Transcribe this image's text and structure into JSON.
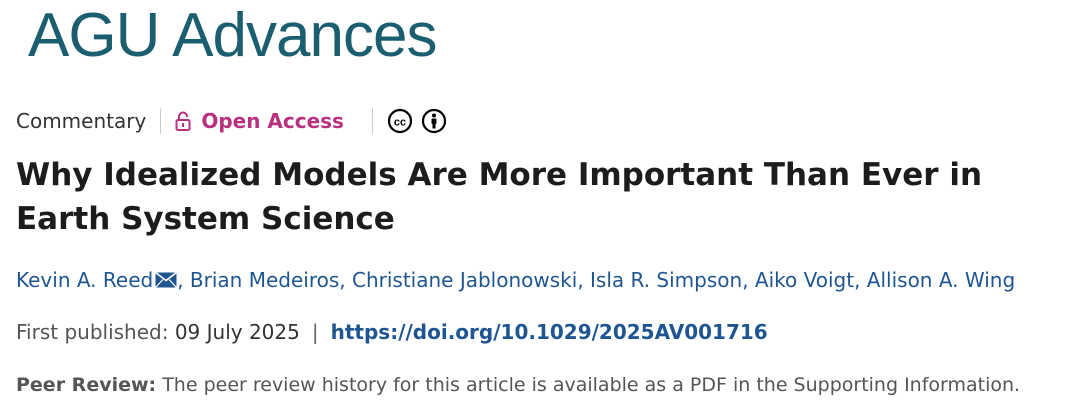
{
  "journal": {
    "name": "AGU Advances",
    "brand_color": "#1a5e6f"
  },
  "article": {
    "type": "Commentary",
    "access": "Open Access",
    "license_icons": [
      "creative-commons-icon",
      "attribution-icon"
    ],
    "title": "Why Idealized Models Are More Important Than Ever in Earth System Science",
    "authors": [
      {
        "name": "Kevin A. Reed",
        "corresponding": true
      },
      {
        "name": "Brian Medeiros"
      },
      {
        "name": "Christiane Jablonowski"
      },
      {
        "name": "Isla R. Simpson"
      },
      {
        "name": "Aiko Voigt"
      },
      {
        "name": "Allison A. Wing"
      }
    ],
    "author_separator": ",",
    "first_published_label": "First published:",
    "first_published_date": "09 July 2025",
    "pipe": "|",
    "doi": "https://doi.org/10.1029/2025AV001716",
    "peer_review_label": "Peer Review:",
    "peer_review_text": "The peer review history for this article is available as a PDF in the Supporting Information."
  },
  "colors": {
    "open_access": "#b8307f",
    "link": "#1f5691",
    "title": "#1c1c1c"
  }
}
